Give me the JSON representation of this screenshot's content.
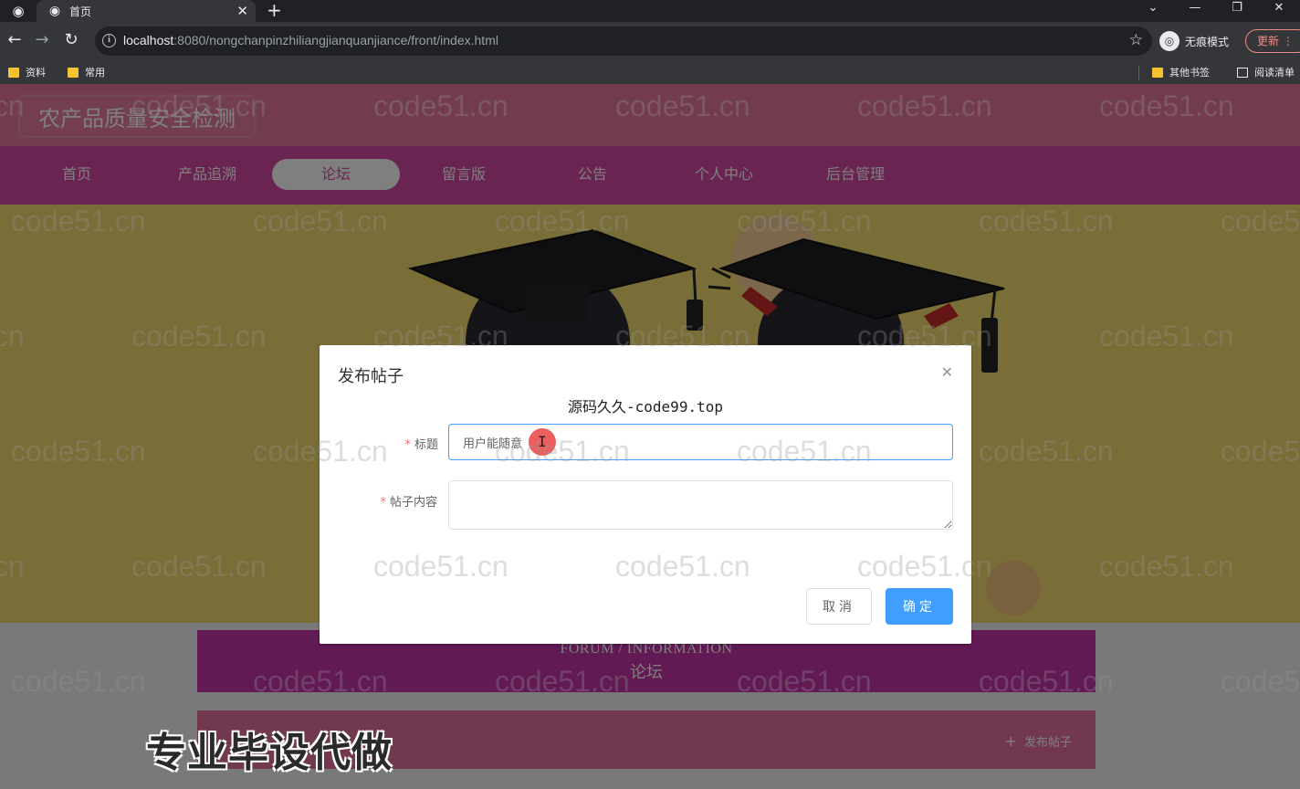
{
  "browser": {
    "tab_title": "首页",
    "url_host": "localhost",
    "url_path": ":8080/nongchanpinzhiliangjianquanjiance/front/index.html",
    "incognito_label": "无痕模式",
    "update_label": "更新",
    "bookmarks": [
      "资料",
      "常用",
      "其他书签",
      "阅读清单"
    ]
  },
  "site": {
    "title": "农产品质量安全检测",
    "nav": [
      "首页",
      "产品追溯",
      "论坛",
      "留言版",
      "公告",
      "个人中心",
      "后台管理"
    ],
    "active_nav": "论坛"
  },
  "forum": {
    "heading_en": "FORUM / INFORMATION",
    "heading_cn": "论坛",
    "post_button": "发布帖子"
  },
  "promo_text": "专业毕设代做",
  "dialog": {
    "title": "发布帖子",
    "subtitle": "源码久久-code99.top",
    "title_label": "标题",
    "title_value": "用户能随意",
    "content_label": "帖子内容",
    "content_value": "",
    "cancel_label": "取消",
    "confirm_label": "确定"
  },
  "watermark": "code51.cn",
  "colors": {
    "header": "#e5779c",
    "nav": "#d548a2",
    "forum_head": "#c234a8",
    "post_bar": "#e2709e",
    "primary": "#409eff"
  }
}
